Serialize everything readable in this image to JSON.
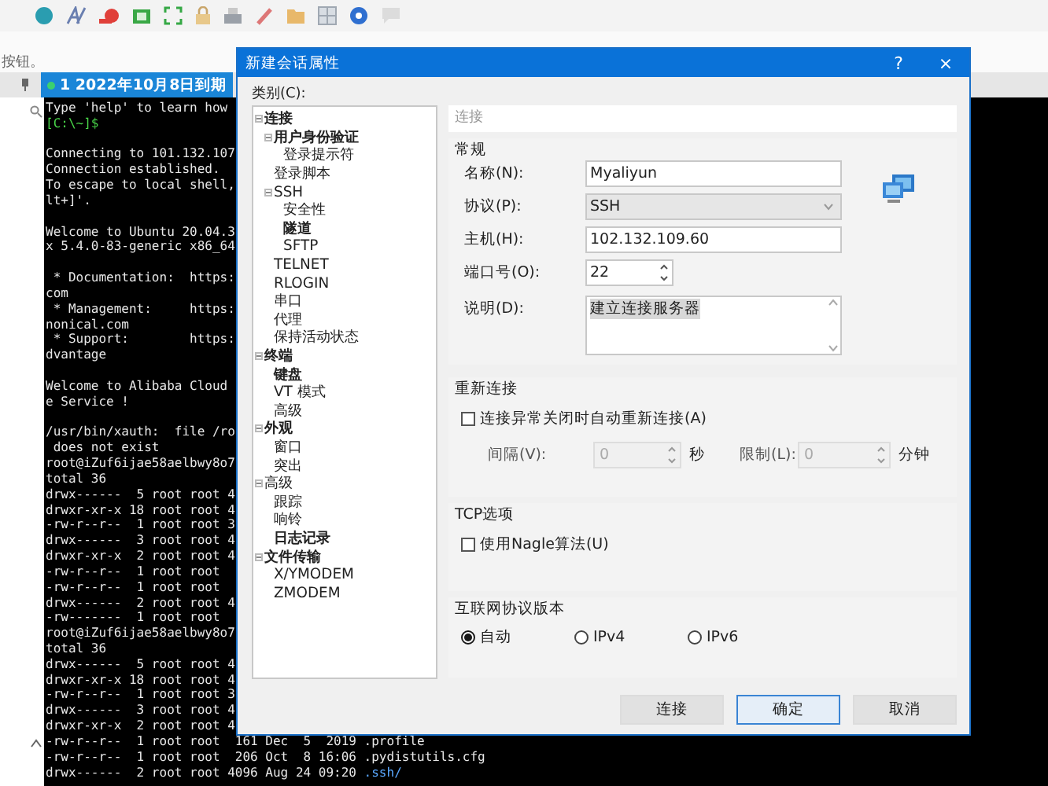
{
  "hint_text": "按钮。",
  "session_tab": {
    "label": "1 2022年10月8日到期",
    "selected": true
  },
  "terminal": {
    "lines": [
      {
        "kind": "output",
        "text": "Type 'help' to learn how"
      },
      {
        "kind": "prompt",
        "text": "[C:\\~]$"
      },
      {
        "kind": "blank"
      },
      {
        "kind": "output",
        "text": "Connecting to 101.132.107"
      },
      {
        "kind": "output",
        "text": "Connection established."
      },
      {
        "kind": "output",
        "text": "To escape to local shell,"
      },
      {
        "kind": "output",
        "text": "lt+]'."
      },
      {
        "kind": "blank"
      },
      {
        "kind": "output",
        "text": "Welcome to Ubuntu 20.04.3"
      },
      {
        "kind": "output",
        "text": "x 5.4.0-83-generic x86_64"
      },
      {
        "kind": "blank"
      },
      {
        "kind": "output",
        "text": " * Documentation:  https:"
      },
      {
        "kind": "output",
        "text": "com"
      },
      {
        "kind": "output",
        "text": " * Management:     https:"
      },
      {
        "kind": "output",
        "text": "nonical.com"
      },
      {
        "kind": "output",
        "text": " * Support:        https:"
      },
      {
        "kind": "output",
        "text": "dvantage"
      },
      {
        "kind": "blank"
      },
      {
        "kind": "output",
        "text": "Welcome to Alibaba Cloud"
      },
      {
        "kind": "output",
        "text": "e Service !"
      },
      {
        "kind": "blank"
      },
      {
        "kind": "output",
        "text": "/usr/bin/xauth:  file /ro"
      },
      {
        "kind": "output",
        "text": " does not exist"
      },
      {
        "kind": "output",
        "text": "root@iZuf6ijae58aelbwy8o7"
      },
      {
        "kind": "output",
        "text": "total 36"
      },
      {
        "kind": "output",
        "text": "drwx------  5 root root 4"
      },
      {
        "kind": "output",
        "text": "drwxr-xr-x 18 root root 4"
      },
      {
        "kind": "output",
        "text": "-rw-r--r--  1 root root 3"
      },
      {
        "kind": "output",
        "text": "drwx------  3 root root 4"
      },
      {
        "kind": "output",
        "text": "drwxr-xr-x  2 root root 4"
      },
      {
        "kind": "output",
        "text": "-rw-r--r--  1 root root"
      },
      {
        "kind": "output",
        "text": "-rw-r--r--  1 root root"
      },
      {
        "kind": "output",
        "text": "drwx------  2 root root 4"
      },
      {
        "kind": "output",
        "text": "-rw-------  1 root root"
      },
      {
        "kind": "output",
        "text": "root@iZuf6ijae58aelbwy8o7"
      },
      {
        "kind": "output",
        "text": "total 36"
      },
      {
        "kind": "output",
        "text": "drwx------  5 root root 4"
      },
      {
        "kind": "output",
        "text": "drwxr-xr-x 18 root root 4"
      },
      {
        "kind": "output",
        "text": "-rw-r--r--  1 root root 3"
      },
      {
        "kind": "output",
        "text": "drwx------  3 root root 4"
      },
      {
        "kind": "output",
        "text": "drwxr-xr-x  2 root root 4"
      }
    ],
    "tail_lines": [
      {
        "kind": "file",
        "text": "-rw-r--r--  1 root root  161 Dec  5  2019",
        "name": ".profile"
      },
      {
        "kind": "file",
        "text": "-rw-r--r--  1 root root  206 Oct  8 16:06",
        "name": ".pydistutils.cfg"
      },
      {
        "kind": "dir",
        "text": "drwx------  2 root root 4096 Aug 24 09:20",
        "name": ".ssh/"
      }
    ]
  },
  "dialog": {
    "title": "新建会话属性",
    "help": "?",
    "close": "×",
    "category_label": "类别(C):",
    "tree": [
      {
        "label": "连接",
        "bold": true,
        "expanded": true,
        "children": [
          {
            "label": "用户身份验证",
            "bold": true,
            "expanded": true,
            "children": [
              {
                "label": "登录提示符",
                "bold": false
              }
            ]
          },
          {
            "label": "登录脚本",
            "bold": false
          },
          {
            "label": "SSH",
            "bold": false,
            "expanded": true,
            "children": [
              {
                "label": "安全性",
                "bold": false
              },
              {
                "label": "隧道",
                "bold": true
              },
              {
                "label": "SFTP",
                "bold": false
              }
            ]
          },
          {
            "label": "TELNET",
            "bold": false
          },
          {
            "label": "RLOGIN",
            "bold": false
          },
          {
            "label": "串口",
            "bold": false
          },
          {
            "label": "代理",
            "bold": false
          },
          {
            "label": "保持活动状态",
            "bold": false
          }
        ]
      },
      {
        "label": "终端",
        "bold": true,
        "expanded": true,
        "children": [
          {
            "label": "键盘",
            "bold": true
          },
          {
            "label": "VT 模式",
            "bold": false
          },
          {
            "label": "高级",
            "bold": false
          }
        ]
      },
      {
        "label": "外观",
        "bold": true,
        "expanded": true,
        "children": [
          {
            "label": "窗口",
            "bold": false
          },
          {
            "label": "突出",
            "bold": false
          }
        ]
      },
      {
        "label": "高级",
        "bold": false,
        "expanded": true,
        "children": [
          {
            "label": "跟踪",
            "bold": false
          },
          {
            "label": "响铃",
            "bold": false
          },
          {
            "label": "日志记录",
            "bold": true
          }
        ]
      },
      {
        "label": "文件传输",
        "bold": true,
        "expanded": true,
        "children": [
          {
            "label": "X/YMODEM",
            "bold": false
          },
          {
            "label": "ZMODEM",
            "bold": false
          }
        ]
      }
    ],
    "panel_header": "连接",
    "general": {
      "title": "常规",
      "fields": [
        {
          "kind": "text",
          "label": "名称(N):",
          "value": "Myaliyun"
        },
        {
          "kind": "select",
          "label": "协议(P):",
          "value": "SSH"
        },
        {
          "kind": "text",
          "label": "主机(H):",
          "value": "102.132.109.60"
        },
        {
          "kind": "spin",
          "label": "端口号(O):",
          "value": "22"
        },
        {
          "kind": "textarea",
          "label": "说明(D):",
          "value": "建立连接服务器",
          "highlighted": true
        }
      ]
    },
    "reconnect": {
      "title": "重新连接",
      "checkbox": {
        "label": "连接异常关闭时自动重新连接(A)",
        "checked": false
      },
      "interval": {
        "label": "间隔(V):",
        "value": "0",
        "unit": "秒",
        "disabled": true
      },
      "limit": {
        "label": "限制(L):",
        "value": "0",
        "unit": "分钟",
        "disabled": true
      }
    },
    "tcp": {
      "title": "TCP选项",
      "checkbox": {
        "label": "使用Nagle算法(U)",
        "checked": false
      }
    },
    "ip_version": {
      "title": "互联网协议版本",
      "options": [
        {
          "label": "自动",
          "selected": true
        },
        {
          "label": "IPv4",
          "selected": false
        },
        {
          "label": "IPv6",
          "selected": false
        }
      ]
    },
    "buttons": [
      {
        "label": "连接",
        "default": false
      },
      {
        "label": "确定",
        "default": true
      },
      {
        "label": "取消",
        "default": false
      }
    ]
  }
}
